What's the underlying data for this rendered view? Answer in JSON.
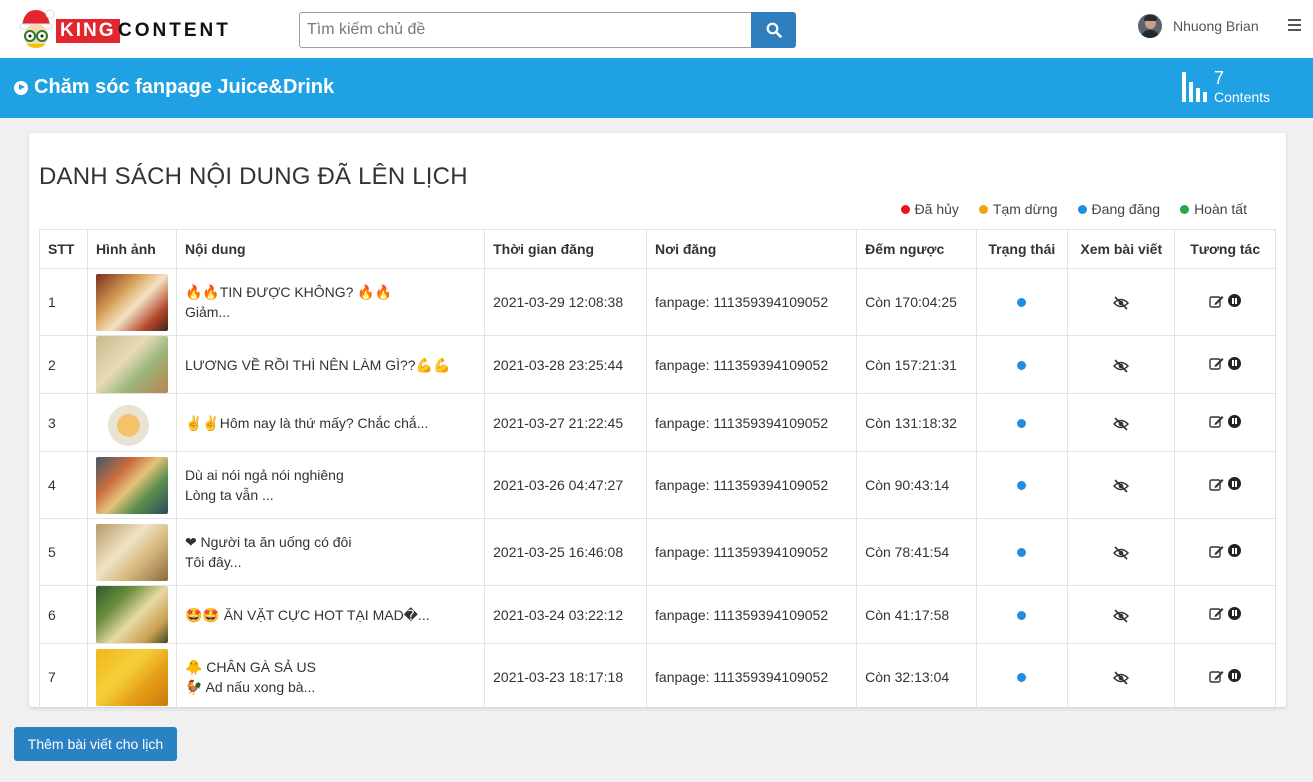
{
  "header": {
    "logo_part1": "KING",
    "logo_part2": "CONTENT",
    "search": {
      "placeholder": "Tìm kiếm chủ đề",
      "icon": "search-icon"
    },
    "user_name": "Nhuong Brian"
  },
  "banner": {
    "title": "Chăm sóc fanpage Juice&Drink",
    "stats_count": "7",
    "stats_label": "Contents"
  },
  "card": {
    "title": "DANH SÁCH NỘI DUNG ĐÃ LÊN LỊCH",
    "legend": [
      {
        "label": "Đã hủy",
        "color": "#e8141a"
      },
      {
        "label": "Tạm dừng",
        "color": "#f0a30a"
      },
      {
        "label": "Đang đăng",
        "color": "#1f8ee0"
      },
      {
        "label": "Hoàn tất",
        "color": "#28a745"
      }
    ],
    "columns": [
      "STT",
      "Hình ảnh",
      "Nội dung",
      "Thời gian đăng",
      "Nơi đăng",
      "Đếm ngược",
      "Trạng thái",
      "Xem bài viết",
      "Tương tác"
    ],
    "rows": [
      {
        "stt": "1",
        "line1": "🔥🔥TIN ĐƯỢC KHÔNG? 🔥🔥",
        "line2": "Giảm...",
        "time": "2021-03-29 12:08:38",
        "place": "fanpage: 111359394109052",
        "countdown": "Còn 170:04:25"
      },
      {
        "stt": "2",
        "line1": "LƯƠNG VỀ RỒI THÌ NÊN LÀM GÌ??💪💪",
        "line2": "",
        "time": "2021-03-28 23:25:44",
        "place": "fanpage: 111359394109052",
        "countdown": "Còn 157:21:31"
      },
      {
        "stt": "3",
        "line1": "✌✌Hôm nay là thứ mấy? Chắc chắ...",
        "line2": "",
        "time": "2021-03-27 21:22:45",
        "place": "fanpage: 111359394109052",
        "countdown": "Còn 131:18:32"
      },
      {
        "stt": "4",
        "line1": "Dù ai nói ngả nói nghiêng",
        "line2": "Lòng ta vẫn ...",
        "time": "2021-03-26 04:47:27",
        "place": "fanpage: 111359394109052",
        "countdown": "Còn 90:43:14"
      },
      {
        "stt": "5",
        "line1": "❤ Người ta ăn uống có đôi",
        "line2": "Tôi đây...",
        "time": "2021-03-25 16:46:08",
        "place": "fanpage: 111359394109052",
        "countdown": "Còn 78:41:54"
      },
      {
        "stt": "6",
        "line1": "🤩🤩 ĂN VẶT CỰC HOT TẠI MAD�...",
        "line2": "",
        "time": "2021-03-24 03:22:12",
        "place": "fanpage: 111359394109052",
        "countdown": "Còn 41:17:58"
      },
      {
        "stt": "7",
        "line1": "🐥 CHÂN GÀ SẢ US",
        "line2": "🐓 Ad nấu xong bà...",
        "time": "2021-03-23 18:17:18",
        "place": "fanpage: 111359394109052",
        "countdown": "Còn 32:13:04"
      }
    ]
  },
  "add_button": "Thêm bài viết cho lịch"
}
